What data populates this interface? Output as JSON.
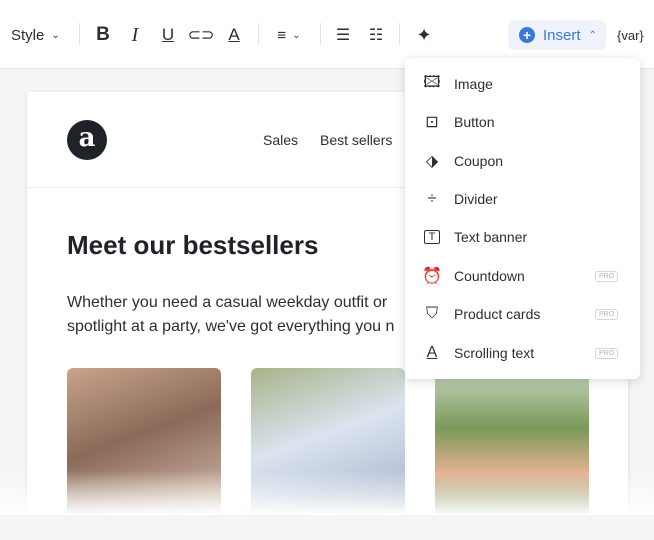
{
  "toolbar": {
    "style_label": "Style",
    "insert_label": "Insert",
    "var_label": "{var}",
    "accent": "#3a78d8"
  },
  "email": {
    "logo_letter": "a",
    "nav": [
      "Sales",
      "Best sellers"
    ],
    "title": "Meet our bestsellers",
    "description_lines": [
      "Whether you need a casual weekday outfit or",
      "spotlight at a party, we've got everything you n"
    ]
  },
  "insert_menu": {
    "items": [
      {
        "label": "Image",
        "icon": "image-icon",
        "pro": false
      },
      {
        "label": "Button",
        "icon": "button-icon",
        "pro": false
      },
      {
        "label": "Coupon",
        "icon": "tag-icon",
        "pro": false
      },
      {
        "label": "Divider",
        "icon": "divider-icon",
        "pro": false
      },
      {
        "label": "Text banner",
        "icon": "text-banner-icon",
        "pro": false
      },
      {
        "label": "Countdown",
        "icon": "alarm-clock-icon",
        "pro": true
      },
      {
        "label": "Product cards",
        "icon": "shopping-bag-icon",
        "pro": true
      },
      {
        "label": "Scrolling text",
        "icon": "scrolling-text-icon",
        "pro": true
      }
    ],
    "pro_label": "PRO"
  }
}
